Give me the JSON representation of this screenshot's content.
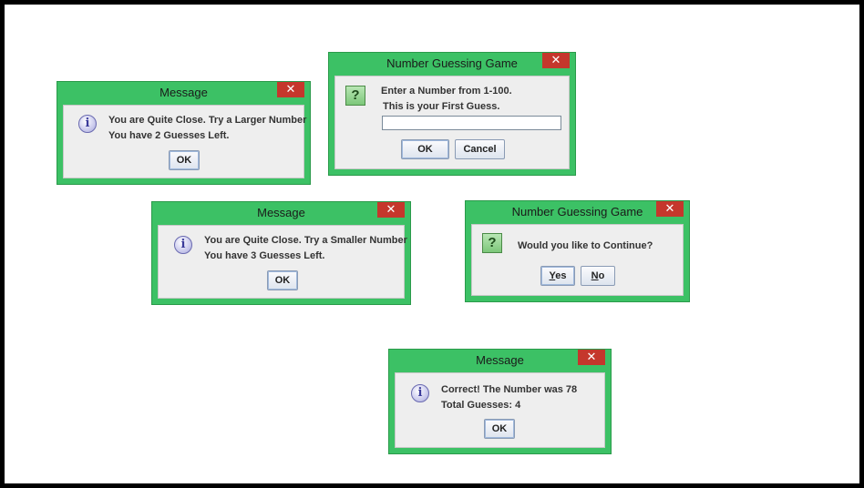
{
  "dialogs": {
    "larger": {
      "title": "Message",
      "close": "✕",
      "line1": "You are Quite Close. Try a Larger Number",
      "line2": "You have 2 Guesses Left.",
      "ok": "OK"
    },
    "input": {
      "title": "Number Guessing Game",
      "close": "✕",
      "line1": "Enter a Number from 1-100.",
      "line2": "This is your First Guess.",
      "input_value": "",
      "ok": "OK",
      "cancel": "Cancel"
    },
    "smaller": {
      "title": "Message",
      "close": "✕",
      "line1": "You are Quite Close. Try a Smaller Number",
      "line2": "You have 3 Guesses Left.",
      "ok": "OK"
    },
    "confirm": {
      "title": "Number Guessing Game",
      "close": "✕",
      "question": "Would you like to Continue?",
      "yes_mnemonic": "Y",
      "yes_rest": "es",
      "no_mnemonic": "N",
      "no_rest": "o"
    },
    "correct": {
      "title": "Message",
      "close": "✕",
      "line1": "Correct! The Number was 78",
      "line2": "Total Guesses: 4",
      "ok": "OK"
    }
  },
  "icons": {
    "info": "i",
    "question": "?"
  },
  "colors": {
    "title_bar": "#3cc165",
    "close_button": "#c5372c",
    "dialog_body": "#eeeeee"
  }
}
